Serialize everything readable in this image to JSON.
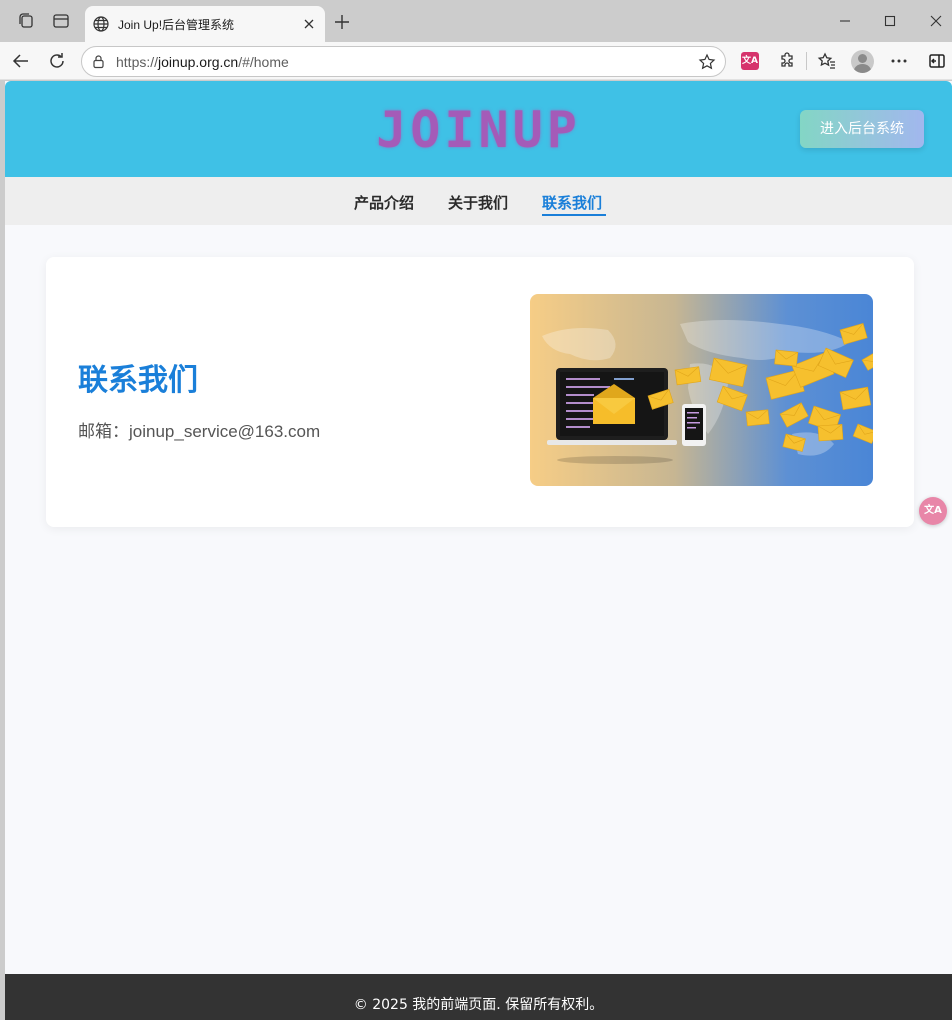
{
  "browser": {
    "tab_title": "Join Up!后台管理系统",
    "url_scheme": "https://",
    "url_host": "joinup.org.cn",
    "url_path": "/#/home",
    "translate_ext_label": "文A"
  },
  "site": {
    "logo_text": "JOINUP",
    "admin_button": "进入后台系统"
  },
  "nav": {
    "items": [
      {
        "label": "产品介绍",
        "active": false
      },
      {
        "label": "关于我们",
        "active": false
      },
      {
        "label": "联系我们",
        "active": true
      }
    ]
  },
  "contact": {
    "title": "联系我们",
    "email_label": "邮箱：",
    "email": "joinup_service@163.com"
  },
  "floating": {
    "translate_label": "文A"
  },
  "footer": {
    "text": "© 2025 我的前端页面. 保留所有权利。"
  },
  "colors": {
    "header_bg": "#3fc1e6",
    "logo": "#a45bb8",
    "accent": "#1a7fd9",
    "footer_bg": "#333333",
    "nav_bg": "#eeeeee"
  }
}
